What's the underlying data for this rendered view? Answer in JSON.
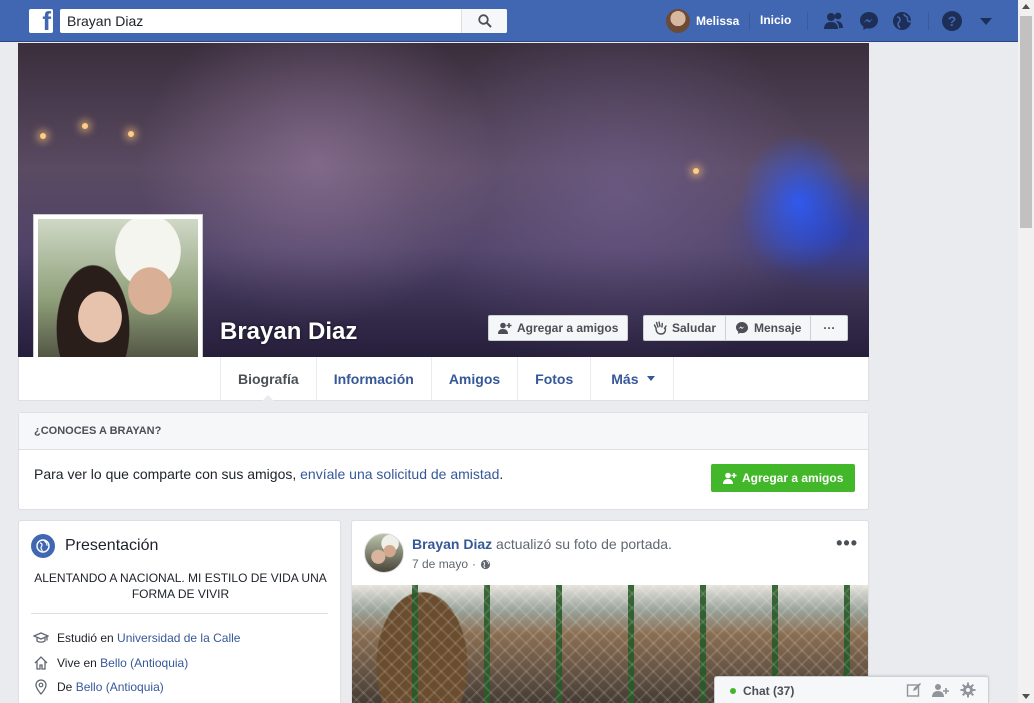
{
  "topbar": {
    "search_value": "Brayan Diaz",
    "user_name": "Melissa",
    "home_label": "Inicio",
    "brand_color": "#4267b2"
  },
  "profile": {
    "name": "Brayan Diaz",
    "add_friend_label": "Agregar a amigos",
    "wave_label": "Saludar",
    "message_label": "Mensaje",
    "more_label": "···"
  },
  "tabs": [
    {
      "label": "Biografía",
      "active": true
    },
    {
      "label": "Información"
    },
    {
      "label": "Amigos"
    },
    {
      "label": "Fotos"
    },
    {
      "label": "Más"
    }
  ],
  "know_card": {
    "header": "¿CONOCES A BRAYAN?",
    "text_prefix": "Para ver lo que comparte con sus amigos, ",
    "link": "envíale una solicitud de amistad",
    "text_suffix": ".",
    "button": "Agregar a amigos"
  },
  "intro": {
    "title": "Presentación",
    "bio": "ALENTANDO A NACIONAL. MI ESTILO DE VIDA UNA FORMA DE VIVIR",
    "facts": [
      {
        "icon": "graduation-cap-icon",
        "prefix": "Estudió en ",
        "link": "Universidad de la Calle"
      },
      {
        "icon": "home-icon",
        "prefix": "Vive en ",
        "link": "Bello (Antioquia)"
      },
      {
        "icon": "location-pin-icon",
        "prefix": "De ",
        "link": "Bello (Antioquia)"
      }
    ]
  },
  "post": {
    "author": "Brayan Diaz",
    "action": " actualizó su foto de portada.",
    "date": "7 de mayo",
    "separator": "·",
    "menu": "•••"
  },
  "chat": {
    "label": "Chat (37)",
    "status_color": "#42b72a"
  }
}
